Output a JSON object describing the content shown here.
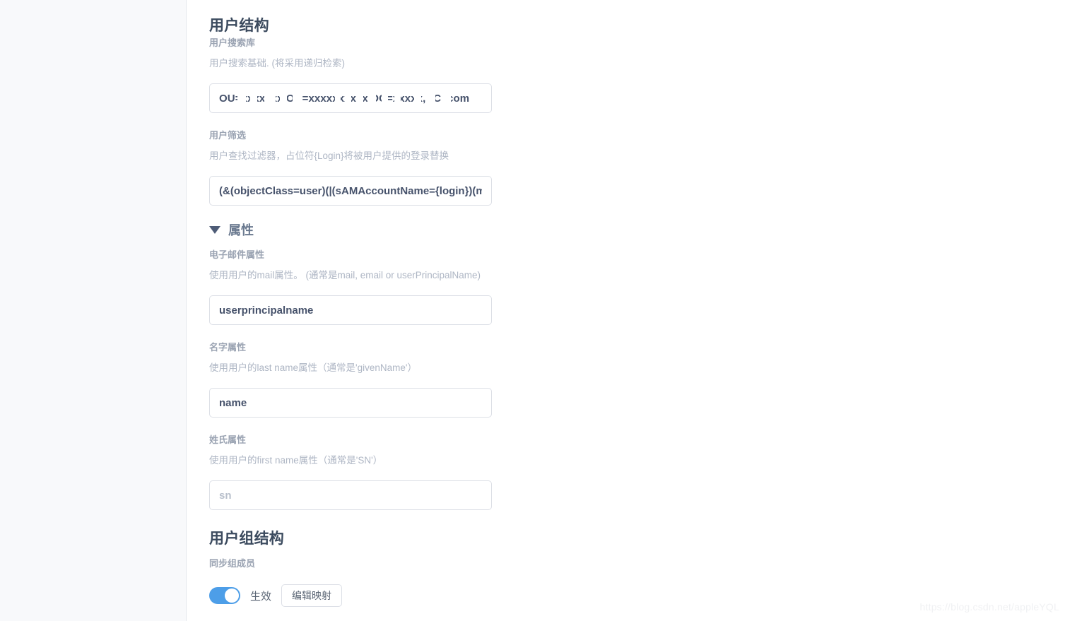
{
  "page": {
    "watermark": "https://blog.csdn.net/appleYQL"
  },
  "user_structure": {
    "heading": "用户结构",
    "fields": [
      {
        "label": "用户搜索库",
        "help": "用户搜索基础. (将采用递归检索)",
        "value": "OU=xxxxxxx,OU=xxxxxxxxxx,DC=xxxxx,DC=com",
        "placeholder": "",
        "redacted": true
      },
      {
        "label": "用户筛选",
        "help": "用户查找过滤器，占位符{Login}将被用户提供的登录替换",
        "value": "(&(objectClass=user)(|(sAMAccountName={login})(mail={login})))",
        "placeholder": "",
        "redacted": false
      }
    ]
  },
  "attributes_group": {
    "toggle_label": "属性",
    "expanded": true,
    "caret_icon": "caret-down-icon",
    "fields": [
      {
        "label": "电子邮件属性",
        "help": "使用用户的mail属性。 (通常是mail, email or userPrincipalName)",
        "value": "userprincipalname",
        "placeholder": ""
      },
      {
        "label": "名字属性",
        "help": "使用用户的last name属性（通常是'givenName'）",
        "value": "name",
        "placeholder": ""
      },
      {
        "label": "姓氏属性",
        "help": "使用用户的first name属性（通常是'SN'）",
        "value": "",
        "placeholder": "sn"
      }
    ]
  },
  "group_structure": {
    "heading": "用户组结构",
    "sync_label": "同步组成员",
    "toggle": {
      "enabled": true,
      "label": "生效"
    },
    "edit_mapping_button": "编辑映射"
  },
  "colors": {
    "accent": "#4d9ee8",
    "heading": "#3b4a5e",
    "label": "#9aa3b2",
    "help": "#aeb6c4",
    "input_border": "#dcdfe6",
    "input_text": "#46526b",
    "rail_bg": "#f8f9fb"
  }
}
